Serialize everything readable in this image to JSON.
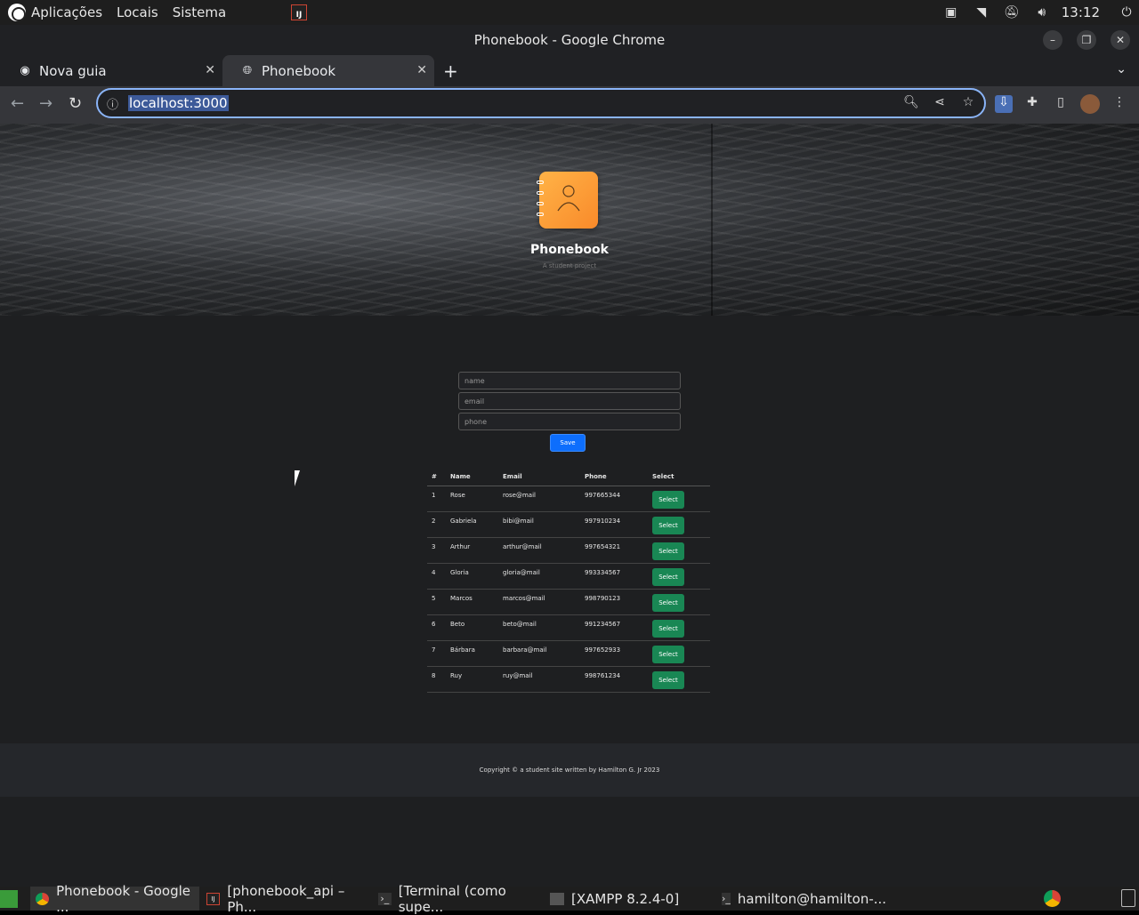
{
  "top_panel": {
    "menus": [
      "Aplicações",
      "Locais",
      "Sistema"
    ],
    "clock": "13:12"
  },
  "window": {
    "title": "Phonebook - Google Chrome"
  },
  "tabs": [
    {
      "label": "Nova guia",
      "active": false
    },
    {
      "label": "Phonebook",
      "active": true
    }
  ],
  "address_bar": {
    "url": "localhost:3000"
  },
  "site": {
    "brand": "Phonebook",
    "tagline": "A student project",
    "form": {
      "name_placeholder": "name",
      "email_placeholder": "email",
      "phone_placeholder": "phone",
      "save_label": "Save"
    },
    "table": {
      "headers": [
        "#",
        "Name",
        "Email",
        "Phone",
        "Select"
      ],
      "rows": [
        {
          "id": "1",
          "name": "Rose",
          "email": "rose@mail",
          "phone": "997665344",
          "action": "Select"
        },
        {
          "id": "2",
          "name": "Gabriela",
          "email": "bibi@mail",
          "phone": "997910234",
          "action": "Select"
        },
        {
          "id": "3",
          "name": "Arthur",
          "email": "arthur@mail",
          "phone": "997654321",
          "action": "Select"
        },
        {
          "id": "4",
          "name": "Gloria",
          "email": "gloria@mail",
          "phone": "993334567",
          "action": "Select"
        },
        {
          "id": "5",
          "name": "Marcos",
          "email": "marcos@mail",
          "phone": "998790123",
          "action": "Select"
        },
        {
          "id": "6",
          "name": "Beto",
          "email": "beto@mail",
          "phone": "991234567",
          "action": "Select"
        },
        {
          "id": "7",
          "name": "Bárbara",
          "email": "barbara@mail",
          "phone": "997652933",
          "action": "Select"
        },
        {
          "id": "8",
          "name": "Ruy",
          "email": "ruy@mail",
          "phone": "998761234",
          "action": "Select"
        }
      ]
    },
    "footer": "Copyright © a student site written by Hamilton G. Jr 2023"
  },
  "taskbar": {
    "items": [
      {
        "label": "Phonebook - Google ...",
        "icon": "chrome-icon",
        "active": true
      },
      {
        "label": "[phonebook_api – Ph...",
        "icon": "intellij-icon",
        "active": false
      },
      {
        "label": "[Terminal (como supe...",
        "icon": "terminal-icon",
        "active": false
      },
      {
        "label": "[XAMPP 8.2.4-0]",
        "icon": "window-icon",
        "active": false
      },
      {
        "label": "hamilton@hamilton-...",
        "icon": "terminal-icon",
        "active": false
      }
    ]
  },
  "colors": {
    "primary_button": "#0d6efd",
    "select_button": "#198754",
    "page_bg": "#1e1f21",
    "accent_outline": "#8ab4f8"
  }
}
